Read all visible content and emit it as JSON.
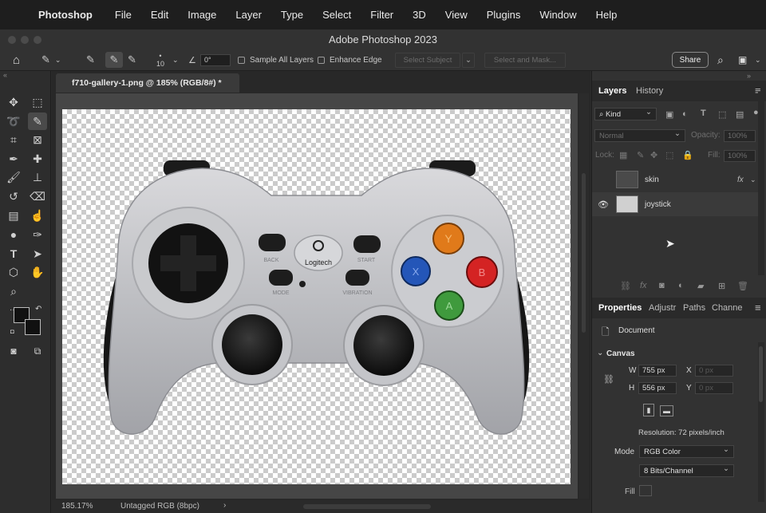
{
  "menubar": {
    "app_name": "Photoshop",
    "items": [
      "File",
      "Edit",
      "Image",
      "Layer",
      "Type",
      "Select",
      "Filter",
      "3D",
      "View",
      "Plugins",
      "Window",
      "Help"
    ]
  },
  "window_title": "Adobe Photoshop 2023",
  "options": {
    "brush_size": "10",
    "angle": "0°",
    "sample_all_layers": "Sample All Layers",
    "enhance_edge": "Enhance Edge",
    "select_subject": "Select Subject",
    "select_and_mask": "Select and Mask...",
    "share": "Share"
  },
  "document": {
    "tab_title": "f710-gallery-1.png @ 185% (RGB/8#) *",
    "zoom": "185.17%",
    "profile": "Untagged RGB (8bpc)",
    "status_arrow": "›"
  },
  "controller_labels": {
    "logo": "Logitech",
    "back": "BACK",
    "start": "START",
    "mode": "MODE",
    "vibration": "VIBRATION",
    "button_x": "X",
    "button_y": "Y",
    "button_b": "B",
    "button_a": "A"
  },
  "colors": {
    "button_y": "#e07a1a",
    "button_x": "#2456b8",
    "button_b": "#d42323",
    "button_a": "#3f9a3d"
  },
  "layers_panel": {
    "tabs": [
      "Layers",
      "History"
    ],
    "filter_kind": "Kind",
    "blend_mode": "Normal",
    "opacity_label": "Opacity:",
    "opacity_value": "100%",
    "lock_label": "Lock:",
    "fill_label": "Fill:",
    "fill_value": "100%",
    "layers": [
      {
        "name": "skin",
        "fx": "fx",
        "visible": false
      },
      {
        "name": "joystick",
        "visible": true
      }
    ]
  },
  "properties_panel": {
    "tabs": [
      "Properties",
      "Adjustr",
      "Paths",
      "Channe"
    ],
    "document_label": "Document",
    "canvas_section": "Canvas",
    "w_label": "W",
    "w_value": "755 px",
    "h_label": "H",
    "h_value": "556 px",
    "x_label": "X",
    "x_value": "0 px",
    "y_label": "Y",
    "y_value": "0 px",
    "resolution": "Resolution: 72 pixels/inch",
    "mode_label": "Mode",
    "mode_value": "RGB Color",
    "bits_value": "8 Bits/Channel",
    "fill_label": "Fill"
  }
}
